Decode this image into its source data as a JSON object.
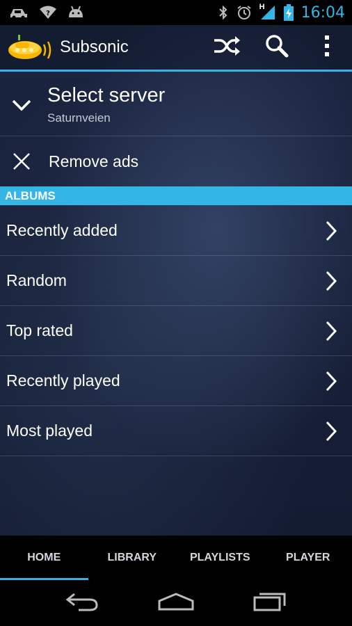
{
  "status_bar": {
    "time": "16:04",
    "network_type": "H",
    "icons": [
      "car-icon",
      "wifi-question-icon",
      "android-icon",
      "bluetooth-icon",
      "alarm-icon",
      "signal-icon",
      "battery-charging-icon"
    ]
  },
  "action_bar": {
    "title": "Subsonic",
    "logo_icon": "subsonic-submarine-icon",
    "actions": [
      "shuffle-icon",
      "search-icon",
      "overflow-menu-icon"
    ]
  },
  "server": {
    "title": "Select server",
    "subtitle": "Saturnveien"
  },
  "ads": {
    "label": "Remove ads"
  },
  "albums": {
    "header": "ALBUMS",
    "items": [
      {
        "label": "Recently added"
      },
      {
        "label": "Random"
      },
      {
        "label": "Top rated"
      },
      {
        "label": "Recently played"
      },
      {
        "label": "Most played"
      }
    ]
  },
  "tabs": [
    {
      "label": "HOME",
      "active": true
    },
    {
      "label": "LIBRARY",
      "active": false
    },
    {
      "label": "PLAYLISTS",
      "active": false
    },
    {
      "label": "PLAYER",
      "active": false
    }
  ],
  "nav": [
    "back-icon",
    "home-icon",
    "recents-icon"
  ],
  "colors": {
    "accent": "#33b5e5",
    "background": "#18213a",
    "status_bar": "#000000"
  }
}
